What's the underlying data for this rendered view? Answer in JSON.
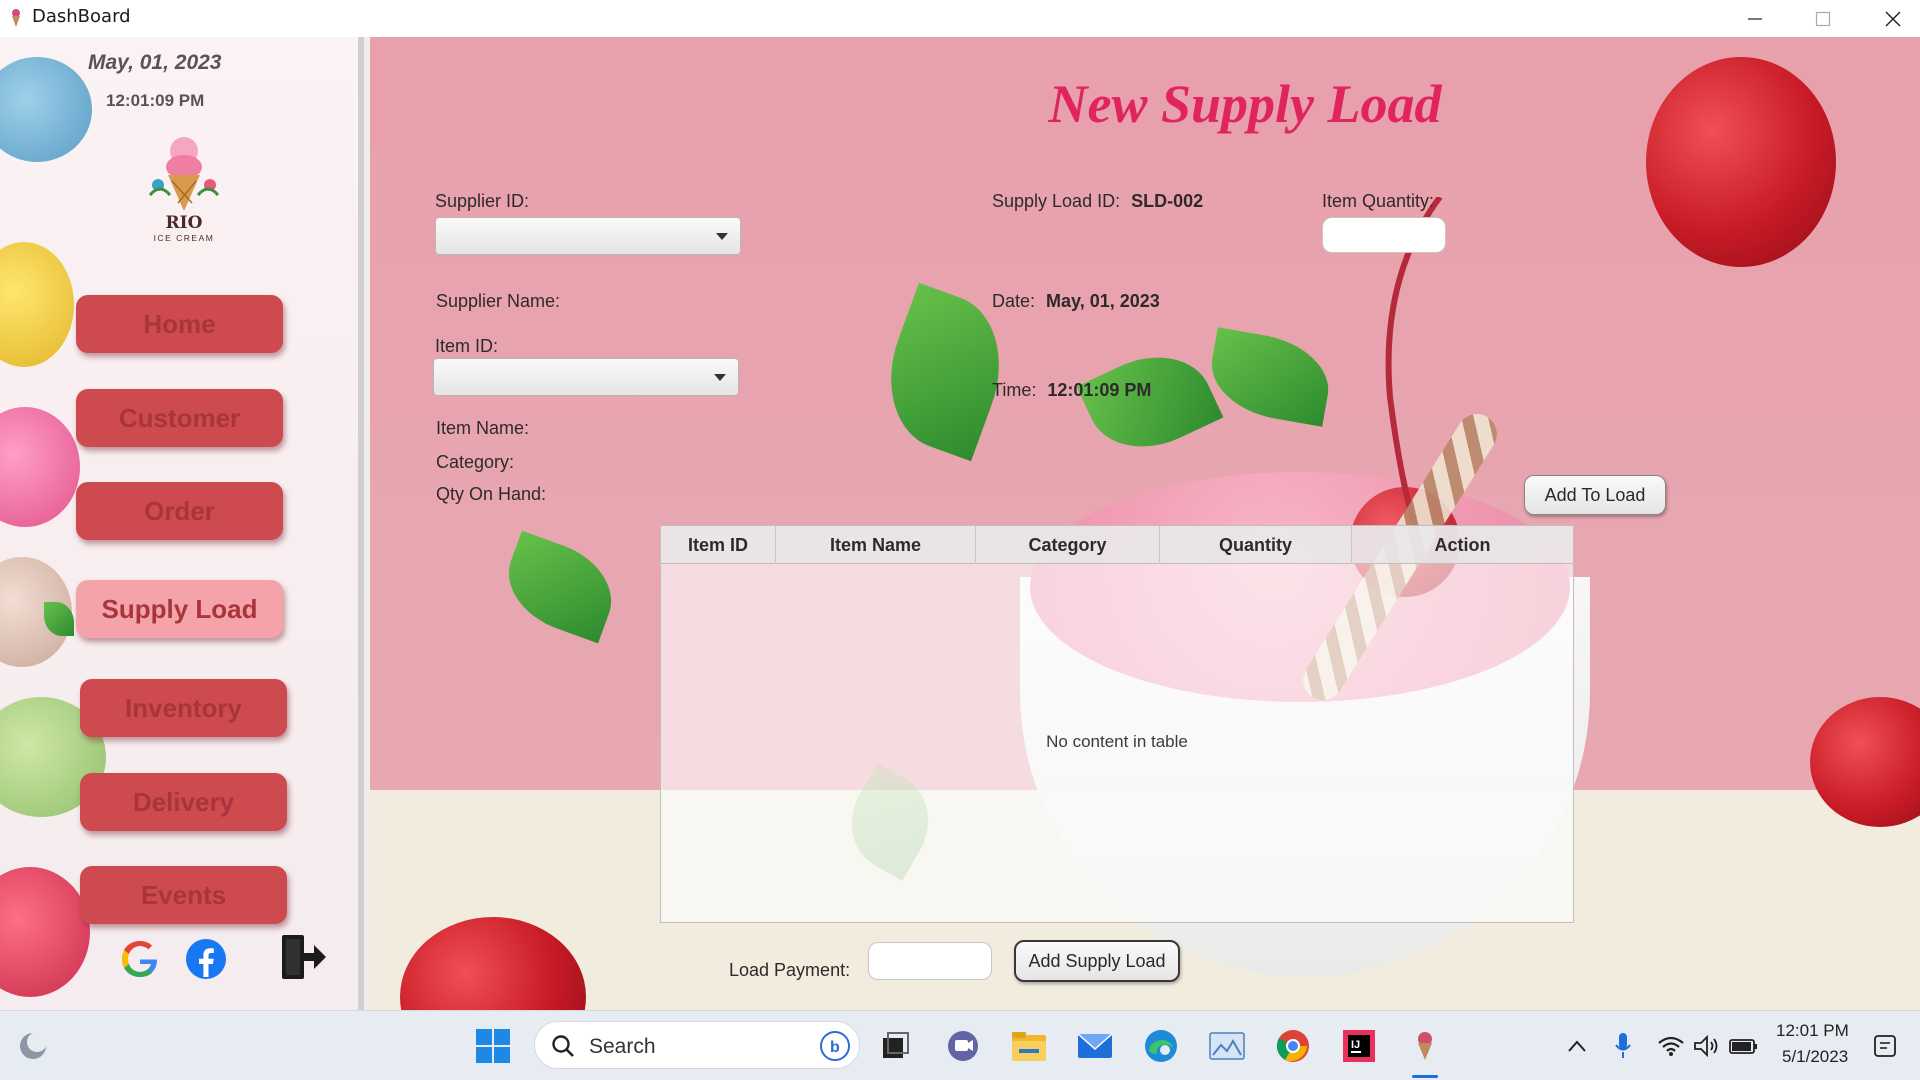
{
  "window": {
    "title": "DashBoard",
    "controls": [
      "minimize",
      "maximize",
      "close"
    ]
  },
  "sidebar": {
    "date": "May,  01, 2023",
    "time": "12:01:09 PM",
    "logo": {
      "title": "RIO",
      "subtitle": "ICE CREAM"
    },
    "nav": [
      {
        "label": "Home",
        "active": false
      },
      {
        "label": "Customer",
        "active": false
      },
      {
        "label": "Order",
        "active": false
      },
      {
        "label": "Supply Load",
        "active": true
      },
      {
        "label": "Inventory",
        "active": false
      },
      {
        "label": "Delivery",
        "active": false
      },
      {
        "label": "Events",
        "active": false
      }
    ],
    "social_icons": [
      "google-icon",
      "facebook-icon",
      "logout-icon"
    ]
  },
  "form": {
    "title": "New Supply Load",
    "supplier_id_label": "Supplier ID:",
    "supplier_id_value": "",
    "supplier_name_label": "Supplier Name:",
    "item_id_label": "Item ID:",
    "item_id_value": "",
    "item_name_label": "Item Name:",
    "category_label": "Category:",
    "qty_on_hand_label": "Qty On Hand:",
    "supply_load_id_label": "Supply Load ID:",
    "supply_load_id_value": "SLD-002",
    "date_label": "Date:",
    "date_value": "May,  01, 2023",
    "time_label": "Time:",
    "time_value": "12:01:09 PM",
    "item_quantity_label": "Item Quantity:",
    "item_quantity_value": "",
    "add_to_load_label": "Add To Load",
    "load_payment_label": "Load Payment:",
    "load_payment_value": "",
    "add_supply_load_label": "Add Supply Load"
  },
  "table": {
    "columns": [
      "Item ID",
      "Item Name",
      "Category",
      "Quantity",
      "Action"
    ],
    "rows": [],
    "empty_text": "No content in table"
  },
  "taskbar": {
    "search_placeholder": "Search",
    "time": "12:01 PM",
    "date": "5/1/2023",
    "apps": [
      "weather-icon",
      "start-icon",
      "bing-icon",
      "task-view-icon",
      "teams-chat-icon",
      "file-explorer-icon",
      "mail-icon",
      "edge-icon",
      "photos-icon",
      "chrome-icon",
      "intellij-icon",
      "java-app-icon"
    ],
    "tray": [
      "chevron-up-icon",
      "microphone-icon",
      "wifi-icon",
      "volume-icon",
      "battery-icon"
    ]
  },
  "colors": {
    "accent_title": "#e0245d",
    "nav_button": "#cd4a4f",
    "nav_button_active": "#f5a3ab",
    "nav_text": "#a8353c",
    "main_background": "#e8a0ab"
  }
}
